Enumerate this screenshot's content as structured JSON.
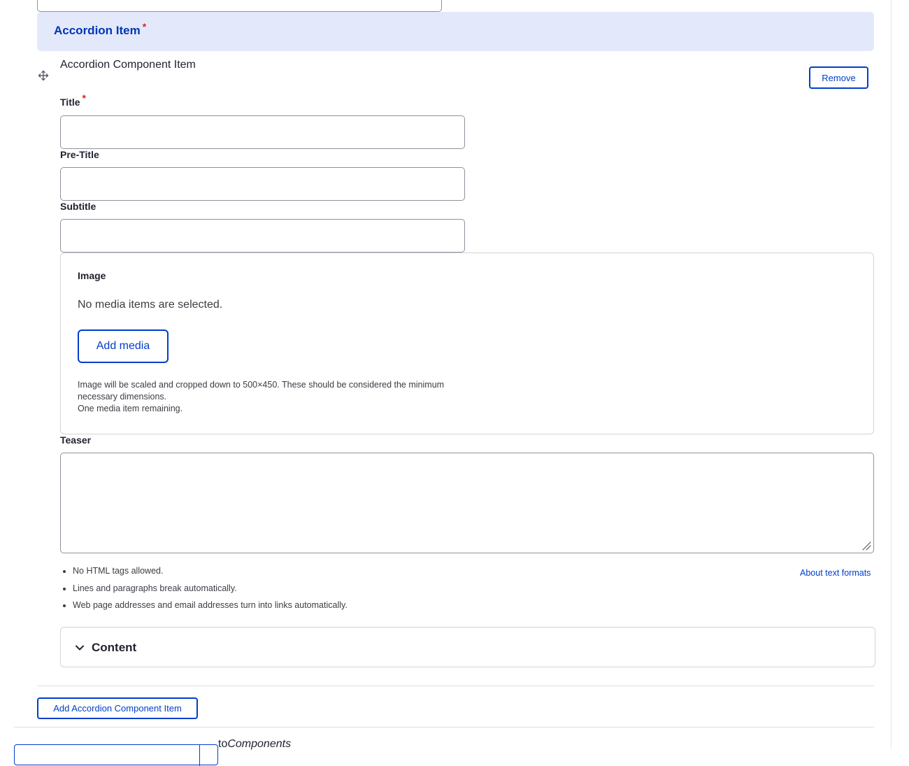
{
  "accordion": {
    "header_label": "Accordion Item",
    "required_mark": "*",
    "item_title": "Accordion Component Item",
    "remove_label": "Remove"
  },
  "fields": {
    "title_label": "Title",
    "pretitle_label": "Pre-Title",
    "subtitle_label": "Subtitle",
    "title_value": "",
    "pretitle_value": "",
    "subtitle_value": ""
  },
  "image": {
    "label": "Image",
    "empty_text": "No media items are selected.",
    "add_label": "Add media",
    "help_line1": "Image will be scaled and cropped down to 500×450. These should be considered the minimum necessary dimensions.",
    "help_line2": "One media item remaining."
  },
  "teaser": {
    "label": "Teaser",
    "value": "",
    "tips": [
      "No HTML tags allowed.",
      "Lines and paragraphs break automatically.",
      "Web page addresses and email addresses turn into links automatically."
    ],
    "about_link": "About text formats"
  },
  "content_section": {
    "label": "Content"
  },
  "add_item_label": "Add Accordion Component Item",
  "bottom": {
    "prefix": "to",
    "target": "Components"
  },
  "icons": {
    "drag": "move-arrows-icon",
    "chevron": "chevron-down-icon",
    "resize": "resize-grip-icon"
  },
  "colors": {
    "accent": "#003ecc",
    "header_bg": "#e3e9fb",
    "header_text": "#0036b1",
    "required": "#dc2323"
  }
}
